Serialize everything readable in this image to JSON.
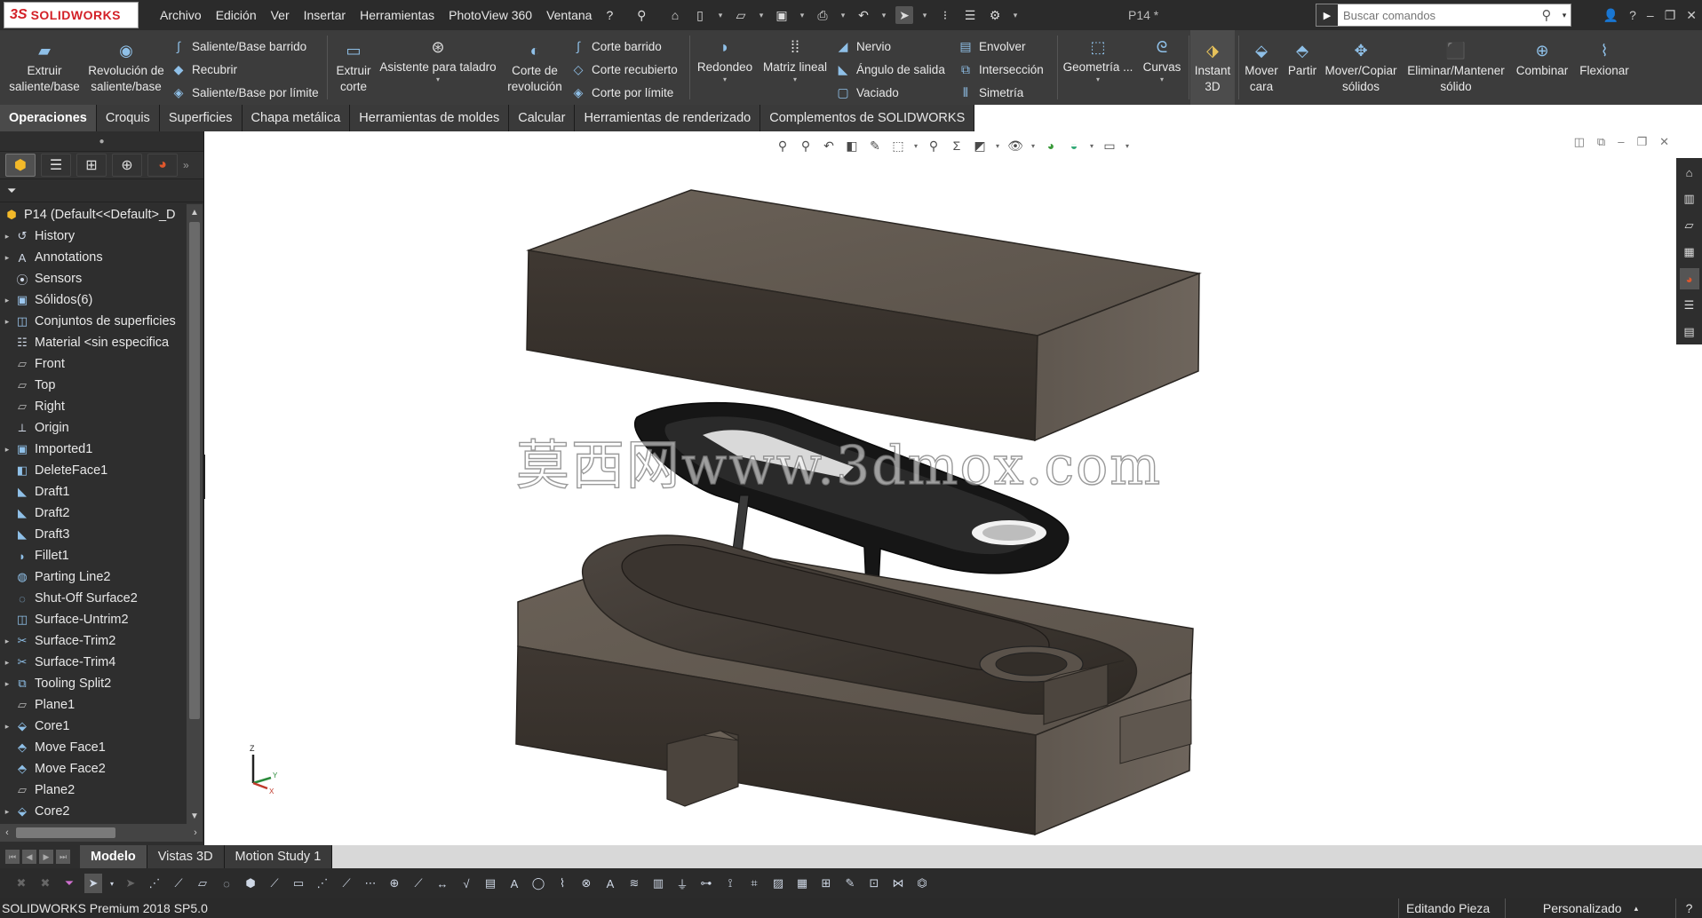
{
  "app": {
    "logo_ds": "3S",
    "logo_name": "SOLIDWORKS",
    "doc_title": "P14 *",
    "menus": [
      "Archivo",
      "Edición",
      "Ver",
      "Insertar",
      "Herramientas",
      "PhotoView 360",
      "Ventana",
      "?"
    ],
    "search_placeholder": "Buscar comandos"
  },
  "ribbon": {
    "extrude_boss": "Extruir saliente/base",
    "revolve_boss": "Revolución de saliente/base",
    "swept_boss": "Saliente/Base barrido",
    "loft": "Recubrir",
    "boundary_boss": "Saliente/Base por límite",
    "extrude_cut": "Extruir corte",
    "hole_wizard": "Asistente para taladro",
    "revolve_cut": "Corte de revolución",
    "swept_cut": "Corte barrido",
    "lofted_cut": "Corte recubierto",
    "boundary_cut": "Corte por límite",
    "fillet": "Redondeo",
    "linear_pattern": "Matriz lineal",
    "rib": "Nervio",
    "draft": "Ángulo de salida",
    "shell": "Vaciado",
    "wrap": "Envolver",
    "intersect": "Intersección",
    "mirror": "Simetría",
    "ref_geometry": "Geometría ...",
    "curves": "Curvas",
    "instant3d": "Instant 3D",
    "move_face": "Mover cara",
    "split": "Partir",
    "move_copy_bodies": "Mover/Copiar sólidos",
    "delete_keep_body": "Eliminar/Mantener sólido",
    "combine": "Combinar",
    "flex": "Flexionar"
  },
  "tabs": [
    "Operaciones",
    "Croquis",
    "Superficies",
    "Chapa metálica",
    "Herramientas de moldes",
    "Calcular",
    "Herramientas de renderizado",
    "Complementos de SOLIDWORKS"
  ],
  "tree": {
    "root": "P14  (Default<<Default>_D",
    "items": [
      {
        "label": "History",
        "icon": "history-icon",
        "exp": true
      },
      {
        "label": "Annotations",
        "icon": "annotations-icon",
        "exp": true
      },
      {
        "label": "Sensors",
        "icon": "sensors-icon",
        "exp": false
      },
      {
        "label": "Sólidos(6)",
        "icon": "solid-bodies-icon",
        "exp": true
      },
      {
        "label": "Conjuntos de superficies",
        "icon": "surface-bodies-icon",
        "exp": true
      },
      {
        "label": "Material <sin especifica",
        "icon": "material-icon",
        "exp": false
      },
      {
        "label": "Front",
        "icon": "plane-icon",
        "exp": false
      },
      {
        "label": "Top",
        "icon": "plane-icon",
        "exp": false
      },
      {
        "label": "Right",
        "icon": "plane-icon",
        "exp": false
      },
      {
        "label": "Origin",
        "icon": "origin-icon",
        "exp": false
      },
      {
        "label": "Imported1",
        "icon": "imported-icon",
        "exp": true
      },
      {
        "label": "DeleteFace1",
        "icon": "delete-face-icon",
        "exp": false
      },
      {
        "label": "Draft1",
        "icon": "draft-icon",
        "exp": false
      },
      {
        "label": "Draft2",
        "icon": "draft-icon",
        "exp": false
      },
      {
        "label": "Draft3",
        "icon": "draft-icon",
        "exp": false
      },
      {
        "label": "Fillet1",
        "icon": "fillet-icon",
        "exp": false
      },
      {
        "label": "Parting Line2",
        "icon": "parting-line-icon",
        "exp": false
      },
      {
        "label": "Shut-Off Surface2",
        "icon": "shutoff-surface-icon",
        "exp": false
      },
      {
        "label": "Surface-Untrim2",
        "icon": "surface-untrim-icon",
        "exp": false
      },
      {
        "label": "Surface-Trim2",
        "icon": "surface-trim-icon",
        "exp": true
      },
      {
        "label": "Surface-Trim4",
        "icon": "surface-trim-icon",
        "exp": true
      },
      {
        "label": "Tooling Split2",
        "icon": "tooling-split-icon",
        "exp": true
      },
      {
        "label": "Plane1",
        "icon": "plane-icon",
        "exp": false
      },
      {
        "label": "Core1",
        "icon": "core-icon",
        "exp": true
      },
      {
        "label": "Move Face1",
        "icon": "move-face-icon",
        "exp": false
      },
      {
        "label": "Move Face2",
        "icon": "move-face-icon",
        "exp": false
      },
      {
        "label": "Plane2",
        "icon": "plane-icon",
        "exp": false
      },
      {
        "label": "Core2",
        "icon": "core-icon",
        "exp": true
      }
    ]
  },
  "viewport": {
    "watermark": "莫西网www.3dmox.com",
    "triad_z": "Z",
    "triad_y": "Y",
    "triad_x": "X"
  },
  "bottom_tabs": [
    "Modelo",
    "Vistas 3D",
    "Motion Study 1"
  ],
  "status": {
    "product": "SOLIDWORKS Premium 2018 SP5.0",
    "mode": "Editando Pieza",
    "units": "Personalizado"
  },
  "colors": {
    "chrome_dark": "#2b2b2b",
    "ribbon_bg": "#3c3c3c",
    "brand_red": "#d32027",
    "model_top": "#5f5750",
    "model_side": "#4a423c",
    "model_dark": "#141414"
  }
}
